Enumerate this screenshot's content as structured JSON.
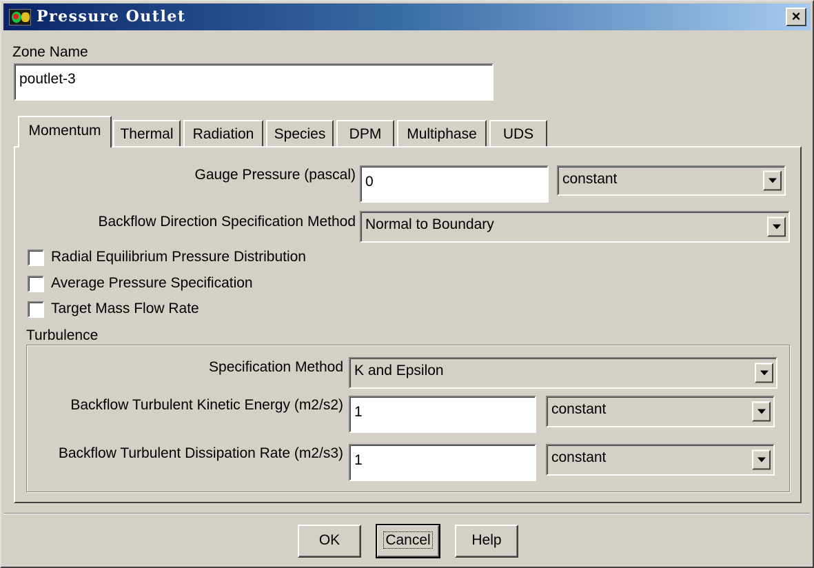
{
  "window": {
    "title": "Pressure Outlet",
    "close_label": "×",
    "icon": "fluent-app-icon"
  },
  "zone": {
    "label": "Zone Name",
    "value": "poutlet-3"
  },
  "tabs": [
    {
      "label": "Momentum",
      "active": true
    },
    {
      "label": "Thermal",
      "active": false
    },
    {
      "label": "Radiation",
      "active": false
    },
    {
      "label": "Species",
      "active": false
    },
    {
      "label": "DPM",
      "active": false
    },
    {
      "label": "Multiphase",
      "active": false
    },
    {
      "label": "UDS",
      "active": false
    }
  ],
  "momentum": {
    "gauge_pressure": {
      "label": "Gauge Pressure (pascal)",
      "value": "0",
      "method": "constant"
    },
    "backflow_direction": {
      "label": "Backflow Direction Specification Method",
      "value": "Normal to Boundary"
    },
    "checkboxes": [
      {
        "label": "Radial Equilibrium Pressure Distribution",
        "checked": false
      },
      {
        "label": "Average Pressure Specification",
        "checked": false
      },
      {
        "label": "Target Mass Flow Rate",
        "checked": false
      }
    ],
    "turbulence": {
      "group_label": "Turbulence",
      "spec_method": {
        "label": "Specification Method",
        "value": "K and Epsilon"
      },
      "kinetic_energy": {
        "label": "Backflow Turbulent Kinetic Energy (m2/s2)",
        "value": "1",
        "method": "constant"
      },
      "dissipation_rate": {
        "label": "Backflow Turbulent Dissipation Rate (m2/s3)",
        "value": "1",
        "method": "constant"
      }
    }
  },
  "buttons": {
    "ok": "OK",
    "cancel": "Cancel",
    "help": "Help"
  },
  "colors": {
    "title_gradient_start": "#0a246a",
    "title_gradient_end": "#a6caf0",
    "face": "#d4d0c8"
  }
}
